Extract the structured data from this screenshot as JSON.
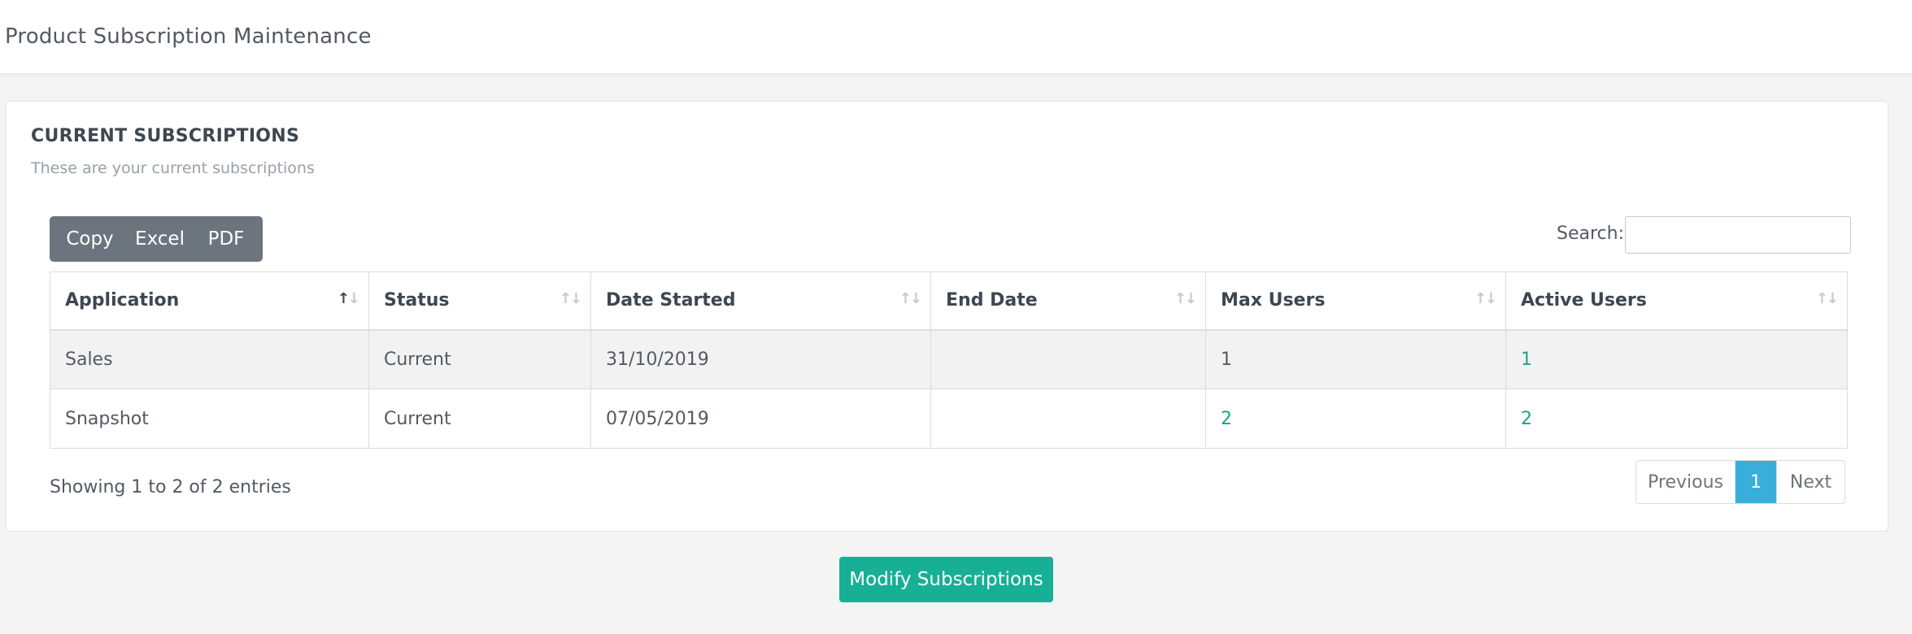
{
  "header": {
    "title": "Product Subscription Maintenance"
  },
  "card": {
    "title": "CURRENT SUBSCRIPTIONS",
    "subtitle": "These are your current subscriptions"
  },
  "toolbar": {
    "export_buttons": [
      "Copy",
      "Excel",
      "PDF"
    ],
    "search_label": "Search:",
    "search_value": ""
  },
  "table": {
    "columns": [
      "Application",
      "Status",
      "Date Started",
      "End Date",
      "Max Users",
      "Active Users"
    ],
    "sorted_column": "Application",
    "rows": [
      {
        "application": "Sales",
        "status": "Current",
        "date_started": "31/10/2019",
        "end_date": "",
        "max_users": "1",
        "active_users": "1"
      },
      {
        "application": "Snapshot",
        "status": "Current",
        "date_started": "07/05/2019",
        "end_date": "",
        "max_users": "2",
        "active_users": "2"
      }
    ]
  },
  "footer": {
    "info": "Showing 1 to 2 of 2 entries",
    "pagination": {
      "previous": "Previous",
      "current_page": "1",
      "next": "Next"
    }
  },
  "actions": {
    "modify_label": "Modify Subscriptions"
  },
  "colors": {
    "accent": "#17b096",
    "link": "#17a589",
    "active_page": "#3aaedb",
    "export_group": "#6c757d"
  },
  "icons": {
    "sort": "sort-arrows-icon"
  }
}
